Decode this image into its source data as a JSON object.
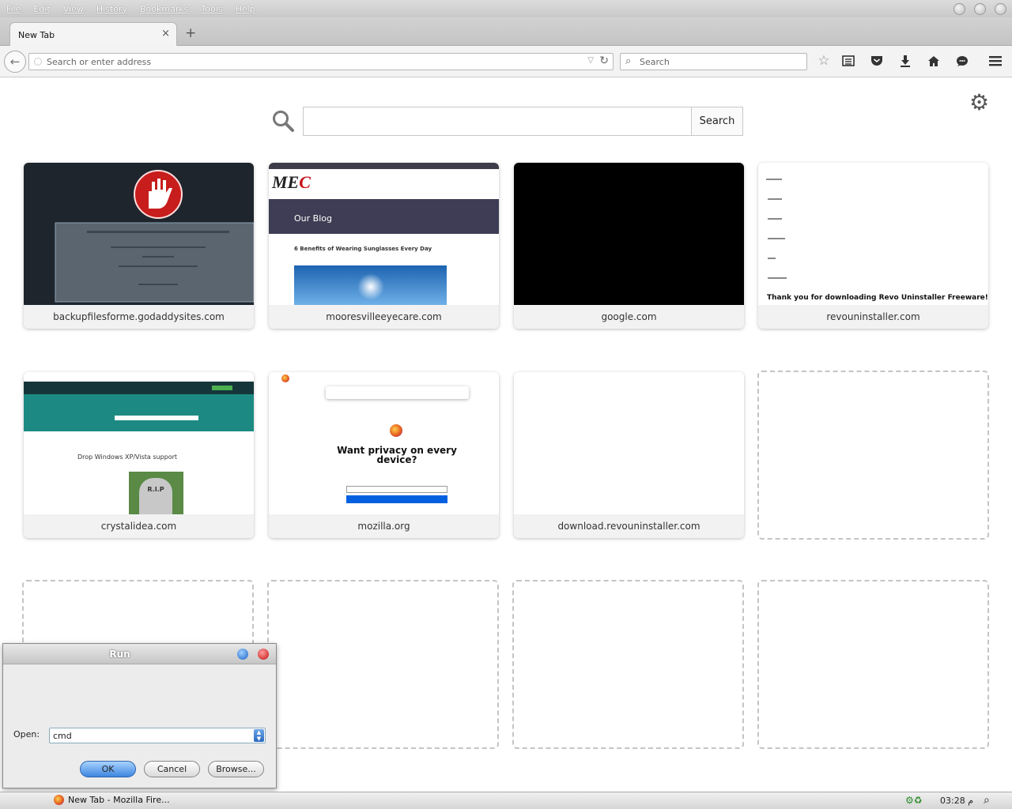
{
  "menu": [
    "File",
    "Edit",
    "View",
    "History",
    "Bookmarks",
    "Tools",
    "Help"
  ],
  "tab": {
    "title": "New Tab",
    "close": "×",
    "new": "+"
  },
  "nav": {
    "url_placeholder": "Search or enter address",
    "search_placeholder": "Search"
  },
  "content": {
    "search_button": "Search"
  },
  "tiles": [
    {
      "label": "backupfilesforme.godaddysites.com"
    },
    {
      "label": "mooresvilleeyecare.com"
    },
    {
      "label": "google.com"
    },
    {
      "label": "revouninstaller.com"
    },
    {
      "label": "crystalidea.com"
    },
    {
      "label": "mozilla.org"
    },
    {
      "label": "download.revouninstaller.com"
    }
  ],
  "thumbs": {
    "moores_blog": "Our Blog",
    "moores_post": "6 Benefits of Wearing Sunglasses Every Day",
    "revo_text": "Thank you for downloading Revo Uninstaller Freeware!",
    "crystal_text": "Drop Windows XP/Vista support",
    "rip": "R.I.P",
    "mozilla_text": "Want privacy on every device?"
  },
  "run": {
    "title": "Run",
    "open_label": "Open:",
    "value": "cmd",
    "ok": "OK",
    "cancel": "Cancel",
    "browse": "Browse..."
  },
  "taskbar": {
    "task": "New Tab - Mozilla Fire...",
    "clock": "03:28 م"
  }
}
